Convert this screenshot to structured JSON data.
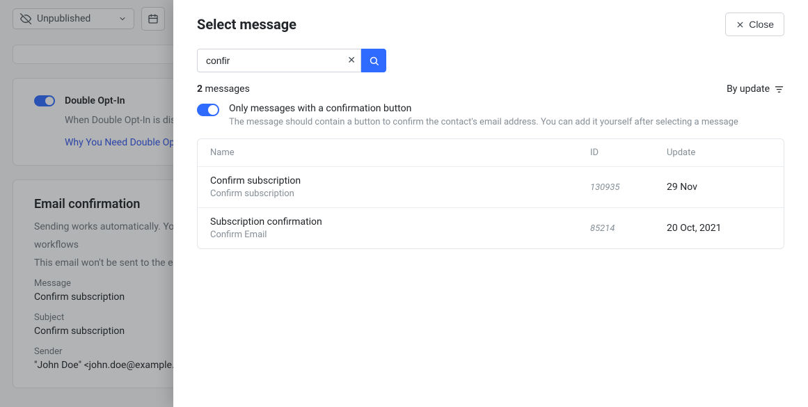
{
  "bg": {
    "status_label": "Unpublished",
    "doubleOptIn": {
      "title": "Double Opt-In",
      "desc": "When Double Opt-In is disabled, ...",
      "link": "Why You Need Double Op..."
    },
    "emailConfirm": {
      "title": "Email confirmation",
      "desc1": "Sending works automatically. You do...",
      "desc2": "workflows",
      "desc3": "This email won't be sent to the exist...",
      "message_label": "Message",
      "message_value": "Confirm subscription",
      "subject_label": "Subject",
      "subject_value": "Confirm subscription",
      "sender_label": "Sender",
      "sender_value": "\"John Doe\" <john.doe@example..."
    }
  },
  "modal": {
    "title": "Select message",
    "close": "Close",
    "search_value": "confir",
    "count_n": "2",
    "count_word": "messages",
    "sort_label": "By update",
    "filter_title": "Only messages with a confirmation button",
    "filter_desc": "The message should contain a button to confirm the contact's email address. You can add it yourself after selecting a message",
    "columns": {
      "name": "Name",
      "id": "ID",
      "update": "Update"
    },
    "rows": [
      {
        "name": "Confirm subscription",
        "sub": "Confirm subscription",
        "id": "130935",
        "date": "29 Nov"
      },
      {
        "name": "Subscription confirmation",
        "sub": "Confirm Email",
        "id": "85214",
        "date": "20 Oct, 2021"
      }
    ]
  }
}
